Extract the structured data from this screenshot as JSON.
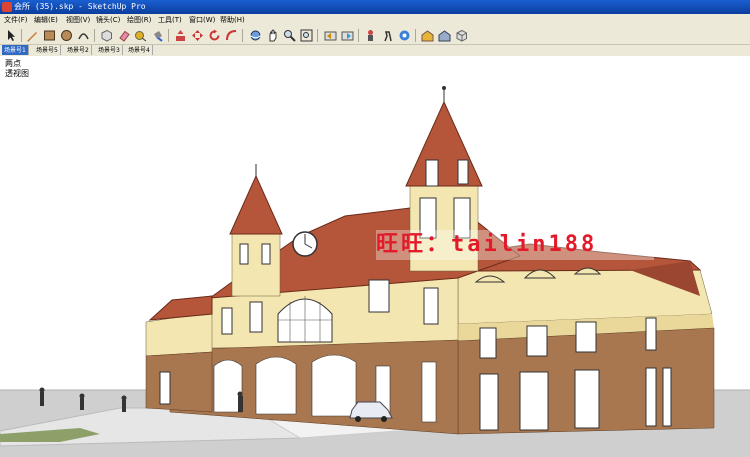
{
  "window": {
    "title": "会所 (35).skp - SketchUp Pro"
  },
  "menu": [
    "文件(F)",
    "编辑(E)",
    "视图(V)",
    "镜头(C)",
    "绘图(R)",
    "工具(T)",
    "窗口(W)",
    "帮助(H)"
  ],
  "toolbar_icons": [
    "select-icon",
    "pencil-icon",
    "rectangle-icon",
    "circle-icon",
    "arc-icon",
    "eraser-icon",
    "paint-bucket-icon",
    "push-pull-icon",
    "move-icon",
    "rotate-icon",
    "scale-icon",
    "offset-icon",
    "orbit-icon",
    "pan-icon",
    "zoom-icon",
    "zoom-extents-icon",
    "previous-view-icon",
    "next-view-icon",
    "position-camera-icon",
    "walk-icon",
    "look-around-icon",
    "get-models-icon",
    "share-model-icon",
    "components-icon"
  ],
  "scene_tabs": [
    "场景号1",
    "场景号5",
    "场景号2",
    "场景号3",
    "场景号4"
  ],
  "active_tab": 0,
  "viewport": {
    "scene_label_1": "两点",
    "scene_label_2": "透视图"
  },
  "watermark": "旺旺：tailin188",
  "colors": {
    "titlebar": "#0b3d9e",
    "chrome": "#ece9d8",
    "active_tab": "#316ac5",
    "roof": "#b5563a",
    "wall": "#f3e6b0",
    "stone": "#a9774f",
    "ground": "#cfcfcf",
    "watermark": "#e21a2a"
  }
}
